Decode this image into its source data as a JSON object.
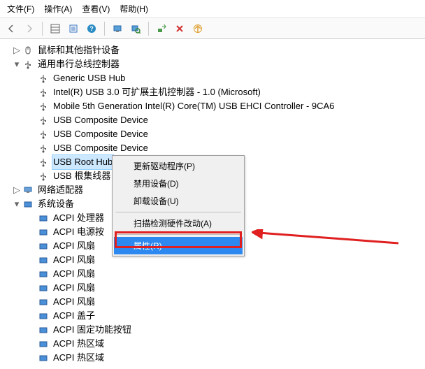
{
  "menu": {
    "file": "文件(F)",
    "action": "操作(A)",
    "view": "查看(V)",
    "help": "帮助(H)"
  },
  "tree": {
    "mouse": "鼠标和其他指针设备",
    "usb_controller": "通用串行总线控制器",
    "usb_items": [
      "Generic USB Hub",
      "Intel(R) USB 3.0 可扩展主机控制器 - 1.0 (Microsoft)",
      "Mobile 5th Generation Intel(R) Core(TM) USB EHCI Controller - 9CA6",
      "USB Composite Device",
      "USB Composite Device",
      "USB Composite Device",
      "USB Root Hub",
      "USB 根集线器"
    ],
    "usb_selected_index": 6,
    "network_adapter": "网络适配器",
    "system_devices": "系统设备",
    "sys_items": [
      "ACPI 处理器",
      "ACPI 电源按",
      "ACPI 风扇",
      "ACPI 风扇",
      "ACPI 风扇",
      "ACPI 风扇",
      "ACPI 风扇",
      "ACPI 盖子",
      "ACPI 固定功能按钮",
      "ACPI 热区域",
      "ACPI 热区域"
    ]
  },
  "context_menu": {
    "update_driver": "更新驱动程序(P)",
    "disable": "禁用设备(D)",
    "uninstall": "卸载设备(U)",
    "scan": "扫描检测硬件改动(A)",
    "properties": "属性(R)"
  }
}
